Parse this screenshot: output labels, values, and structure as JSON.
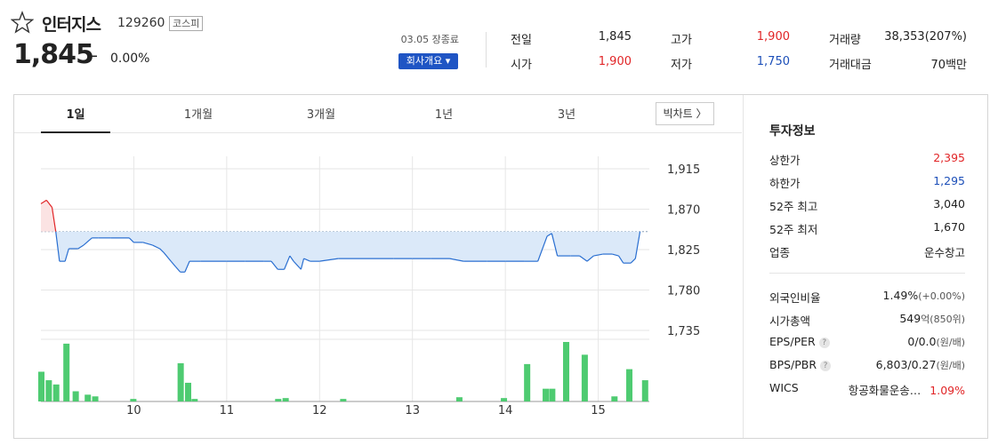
{
  "header": {
    "name": "인터지스",
    "code": "129260",
    "market": "코스피",
    "price": "1,845",
    "change_symbol": "–",
    "change_pct": "0.00%",
    "date_label": "03.05 장종료",
    "company_button": "회사개요 ▾"
  },
  "summary": {
    "prev_label": "전일",
    "prev_value": "1,845",
    "open_label": "시가",
    "open_value": "1,900",
    "high_label": "고가",
    "high_value": "1,900",
    "low_label": "저가",
    "low_value": "1,750",
    "volume_label": "거래량",
    "volume_value": "38,353(207%)",
    "amount_label": "거래대금",
    "amount_value": "70백만"
  },
  "tabs": [
    "1일",
    "1개월",
    "3개월",
    "1년",
    "3년"
  ],
  "big_chart_button": "빅차트 〉",
  "info": {
    "title": "투자정보",
    "rows1": [
      {
        "label": "상한가",
        "value": "2,395",
        "color": "#e12527"
      },
      {
        "label": "하한가",
        "value": "1,295",
        "color": "#1b4eb8"
      },
      {
        "label": "52주 최고",
        "value": "3,040",
        "color": "#222222"
      },
      {
        "label": "52주 최저",
        "value": "1,670",
        "color": "#222222"
      },
      {
        "label": "업종",
        "value": "운수창고",
        "color": "#222222"
      }
    ],
    "foreign_label": "외국인비율",
    "foreign_value": "1.49%",
    "foreign_change": "(+0.00%)",
    "mcap_label": "시가총액",
    "mcap_value": "549",
    "mcap_unit": "억(850위)",
    "eps_label": "EPS/PER",
    "eps_value": "0/0.0",
    "eps_unit": "(원/배)",
    "bps_label": "BPS/PBR",
    "bps_value": "6,803/0.27",
    "bps_unit": "(원/배)",
    "wics_label": "WICS",
    "wics_value": "항공화물운송…",
    "wics_pct": "1.09%",
    "help_mark": "?"
  },
  "chart_data": {
    "type": "line",
    "y_ticks": [
      "1,915",
      "1,870",
      "1,825",
      "1,780",
      "1,735"
    ],
    "ylim": [
      1735,
      1915
    ],
    "x_ticks": [
      "10",
      "11",
      "12",
      "13",
      "14",
      "15"
    ],
    "reference_price": 1845,
    "price_series": [
      [
        9.0,
        1876
      ],
      [
        9.06,
        1880
      ],
      [
        9.12,
        1872
      ],
      [
        9.16,
        1845
      ],
      [
        9.2,
        1812
      ],
      [
        9.26,
        1812
      ],
      [
        9.3,
        1826
      ],
      [
        9.4,
        1826
      ],
      [
        9.46,
        1830
      ],
      [
        9.55,
        1838
      ],
      [
        9.62,
        1838
      ],
      [
        9.75,
        1838
      ],
      [
        9.95,
        1838
      ],
      [
        10.0,
        1833
      ],
      [
        10.1,
        1833
      ],
      [
        10.2,
        1830
      ],
      [
        10.28,
        1826
      ],
      [
        10.32,
        1822
      ],
      [
        10.4,
        1812
      ],
      [
        10.45,
        1806
      ],
      [
        10.5,
        1800
      ],
      [
        10.55,
        1800
      ],
      [
        10.6,
        1812
      ],
      [
        10.72,
        1812
      ],
      [
        11.0,
        1812
      ],
      [
        11.2,
        1812
      ],
      [
        11.4,
        1812
      ],
      [
        11.48,
        1812
      ],
      [
        11.55,
        1803
      ],
      [
        11.62,
        1803
      ],
      [
        11.68,
        1818
      ],
      [
        11.72,
        1812
      ],
      [
        11.8,
        1803
      ],
      [
        11.83,
        1815
      ],
      [
        11.9,
        1812
      ],
      [
        12.0,
        1812
      ],
      [
        12.2,
        1815
      ],
      [
        12.5,
        1815
      ],
      [
        12.8,
        1815
      ],
      [
        13.0,
        1815
      ],
      [
        13.2,
        1815
      ],
      [
        13.4,
        1815
      ],
      [
        13.55,
        1812
      ],
      [
        13.8,
        1812
      ],
      [
        14.0,
        1812
      ],
      [
        14.2,
        1812
      ],
      [
        14.35,
        1812
      ],
      [
        14.45,
        1840
      ],
      [
        14.5,
        1843
      ],
      [
        14.56,
        1818
      ],
      [
        14.7,
        1818
      ],
      [
        14.8,
        1818
      ],
      [
        14.88,
        1812
      ],
      [
        14.95,
        1818
      ],
      [
        15.05,
        1820
      ],
      [
        15.15,
        1820
      ],
      [
        15.22,
        1818
      ],
      [
        15.27,
        1810
      ],
      [
        15.35,
        1810
      ],
      [
        15.4,
        1815
      ],
      [
        15.45,
        1845
      ]
    ],
    "volume_series": [
      [
        9.0,
        35
      ],
      [
        9.08,
        25
      ],
      [
        9.16,
        20
      ],
      [
        9.27,
        68
      ],
      [
        9.37,
        12
      ],
      [
        9.5,
        8
      ],
      [
        9.58,
        6
      ],
      [
        9.99,
        3
      ],
      [
        10.5,
        45
      ],
      [
        10.58,
        22
      ],
      [
        10.65,
        3
      ],
      [
        11.55,
        3
      ],
      [
        11.63,
        4
      ],
      [
        12.25,
        3
      ],
      [
        13.5,
        5
      ],
      [
        13.98,
        4
      ],
      [
        14.23,
        44
      ],
      [
        14.43,
        15
      ],
      [
        14.5,
        15
      ],
      [
        14.65,
        70
      ],
      [
        14.85,
        55
      ],
      [
        15.17,
        6
      ],
      [
        15.33,
        38
      ],
      [
        15.5,
        25
      ]
    ],
    "volume_max": 70
  }
}
